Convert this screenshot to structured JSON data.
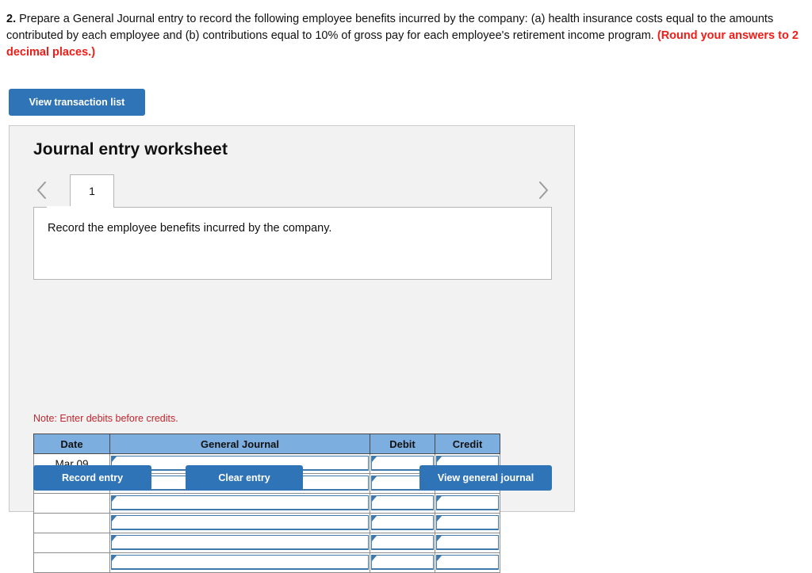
{
  "prompt": {
    "number": "2.",
    "body": "Prepare a General Journal entry to record the following employee benefits incurred by the company: (a) health insurance costs equal to the amounts contributed by each employee and (b) contributions equal to 10% of gross pay for each employee's retirement income program.",
    "round_note": "(Round your answers to 2 decimal places.)"
  },
  "toolbar": {
    "view_transaction_list": "View transaction list"
  },
  "worksheet": {
    "title": "Journal entry worksheet",
    "tabs": [
      {
        "label": "1",
        "active": true
      }
    ],
    "prev_arrow_icon": "chevron-left-icon",
    "next_arrow_icon": "chevron-right-icon",
    "description": "Record the employee benefits incurred by the company.",
    "note": "Note: Enter debits before credits."
  },
  "table": {
    "headers": [
      "Date",
      "General Journal",
      "Debit",
      "Credit"
    ],
    "rows": [
      {
        "date": "Mar 09",
        "general_journal": "",
        "debit": "",
        "credit": ""
      },
      {
        "date": "",
        "general_journal": "",
        "debit": "",
        "credit": ""
      },
      {
        "date": "",
        "general_journal": "",
        "debit": "",
        "credit": ""
      },
      {
        "date": "",
        "general_journal": "",
        "debit": "",
        "credit": ""
      },
      {
        "date": "",
        "general_journal": "",
        "debit": "",
        "credit": ""
      },
      {
        "date": "",
        "general_journal": "",
        "debit": "",
        "credit": ""
      }
    ]
  },
  "footer": {
    "record_entry": "Record entry",
    "clear_entry": "Clear entry",
    "view_general_journal": "View general journal"
  },
  "colors": {
    "button_blue": "#3074b8",
    "header_blue": "#7cafe0",
    "field_border_blue": "#3f78ab",
    "note_red": "#c0272d",
    "prompt_red": "#ef1d17",
    "panel_bg": "#f2f2f2"
  }
}
